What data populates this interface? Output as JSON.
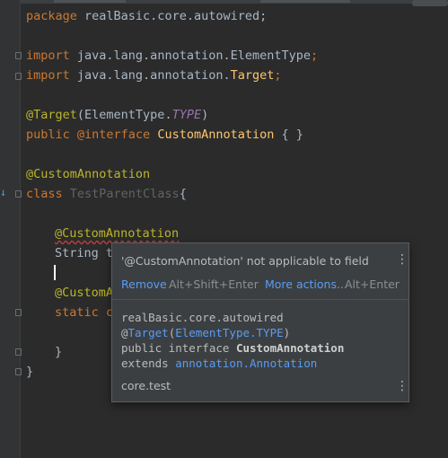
{
  "editor": {
    "lines": {
      "l1": {
        "kw": "package",
        "rest": " realBasic.core.autowired;"
      },
      "l3": {
        "kw": "import",
        "a": " java.lang.annotation.ElementType",
        "semi": ";"
      },
      "l4": {
        "kw": "import",
        "a": " java.lang.annotation.",
        "cls": "Target",
        "semi": ";"
      },
      "l6": {
        "ann": "@Target",
        "a": "(ElementType.",
        "type": "TYPE",
        "b": ")"
      },
      "l7": {
        "kw": "public",
        "ann": " @interface",
        "cls": " CustomAnnotation",
        "b": " { }"
      },
      "l9": {
        "ann": "@CustomAnnotation"
      },
      "l10": {
        "kw": "class",
        "dim": " TestParentClass",
        "b": "{"
      },
      "l12": {
        "ann": "@CustomAnnotation"
      },
      "l13": {
        "a": "String t"
      },
      "l15": {
        "ann": "@CustomA"
      },
      "l16": {
        "kw": "static c"
      },
      "l18": {
        "b": "}"
      },
      "l19": {
        "b": "}"
      }
    }
  },
  "popup": {
    "message": "'@CustomAnnotation' not applicable to field",
    "menu_icon": "more-vertical-icon",
    "actions": [
      {
        "label": "Remove",
        "shortcut": "Alt+Shift+Enter"
      },
      {
        "label": "More actions...",
        "shortcut": "Alt+Enter"
      }
    ],
    "doc": {
      "package": "realBasic.core.autowired",
      "ann_prefix": "@",
      "ann_target": "Target",
      "ann_open": "(",
      "ann_arg": "ElementType.TYPE",
      "ann_close": ")",
      "decl_prefix": "public interface ",
      "decl_name": "CustomAnnotation",
      "extends_kw": "extends ",
      "extends_link": "annotation.Annotation",
      "module": "core.test"
    }
  },
  "colors": {
    "background": "#2b2b2b",
    "keyword": "#cc7832",
    "annotation": "#bbb529",
    "link": "#589df6"
  }
}
